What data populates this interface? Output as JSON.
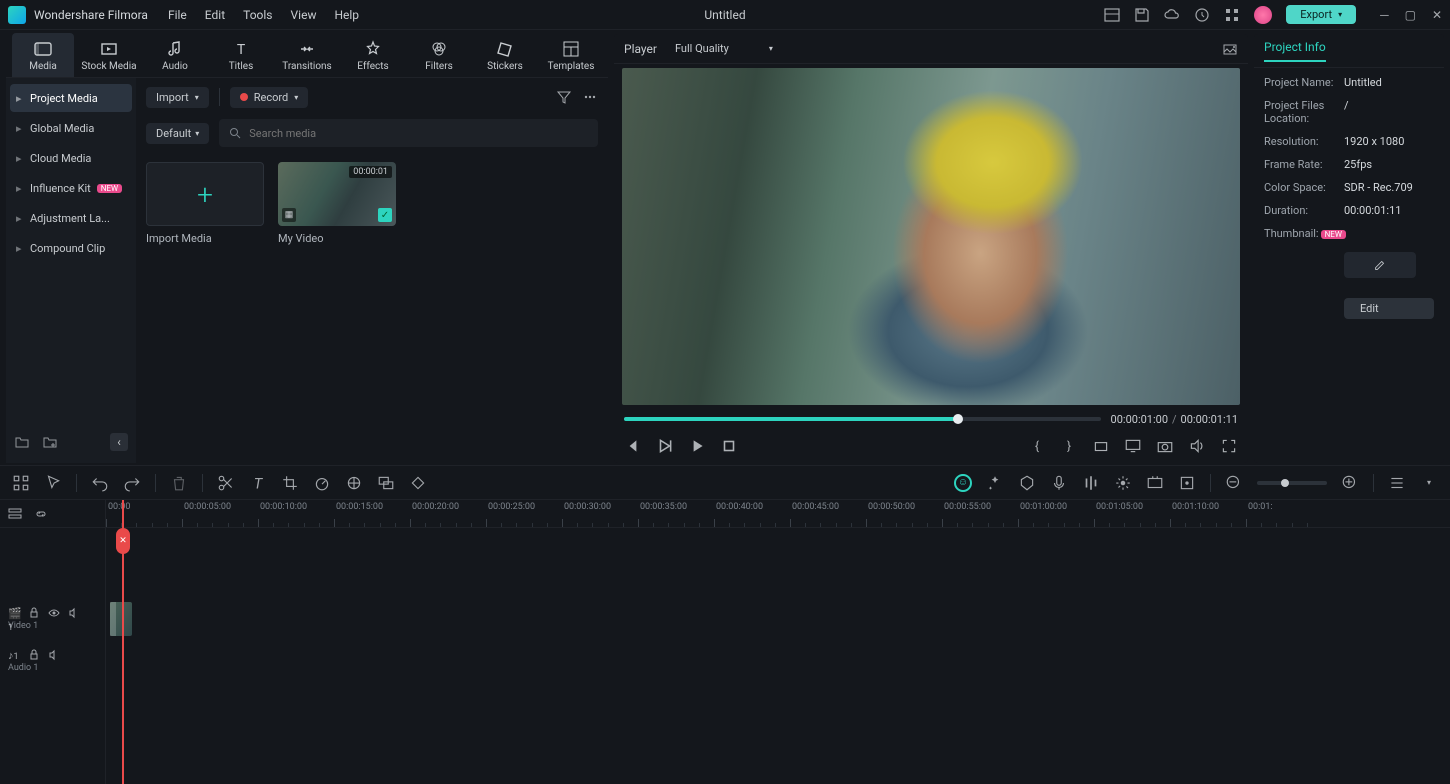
{
  "app": {
    "name": "Wondershare Filmora",
    "document": "Untitled"
  },
  "menu": [
    "File",
    "Edit",
    "Tools",
    "View",
    "Help"
  ],
  "export_label": "Export",
  "asset_tabs": [
    {
      "id": "media",
      "label": "Media"
    },
    {
      "id": "stock",
      "label": "Stock Media"
    },
    {
      "id": "audio",
      "label": "Audio"
    },
    {
      "id": "titles",
      "label": "Titles"
    },
    {
      "id": "transitions",
      "label": "Transitions"
    },
    {
      "id": "effects",
      "label": "Effects"
    },
    {
      "id": "filters",
      "label": "Filters"
    },
    {
      "id": "stickers",
      "label": "Stickers"
    },
    {
      "id": "templates",
      "label": "Templates"
    }
  ],
  "library": {
    "items": [
      {
        "label": "Project Media",
        "active": true
      },
      {
        "label": "Global Media"
      },
      {
        "label": "Cloud Media"
      },
      {
        "label": "Influence Kit",
        "badge": "NEW"
      },
      {
        "label": "Adjustment La..."
      },
      {
        "label": "Compound Clip"
      }
    ]
  },
  "media_tools": {
    "import": "Import",
    "record": "Record",
    "filter": "Default",
    "search_placeholder": "Search media"
  },
  "media_items": [
    {
      "kind": "import",
      "label": "Import Media"
    },
    {
      "kind": "video",
      "label": "My Video",
      "duration": "00:00:01"
    }
  ],
  "player": {
    "title": "Player",
    "quality": "Full Quality",
    "current_tc": "00:00:01:00",
    "total_tc": "00:00:01:11",
    "progress_pct": 70
  },
  "project_info": {
    "tab": "Project Info",
    "rows": {
      "name_k": "Project Name:",
      "name_v": "Untitled",
      "loc_k": "Project Files Location:",
      "loc_v": "/",
      "res_k": "Resolution:",
      "res_v": "1920 x 1080",
      "fps_k": "Frame Rate:",
      "fps_v": "25fps",
      "cs_k": "Color Space:",
      "cs_v": "SDR - Rec.709",
      "dur_k": "Duration:",
      "dur_v": "00:00:01:11",
      "thumb_k": "Thumbnail:"
    },
    "edit": "Edit"
  },
  "timeline": {
    "ticks": [
      "00:00",
      "00:00:05:00",
      "00:00:10:00",
      "00:00:15:00",
      "00:00:20:00",
      "00:00:25:00",
      "00:00:30:00",
      "00:00:35:00",
      "00:00:40:00",
      "00:00:45:00",
      "00:00:50:00",
      "00:00:55:00",
      "00:01:00:00",
      "00:01:05:00",
      "00:01:10:00",
      "00:01:"
    ],
    "tracks": [
      {
        "name": "Video 1",
        "type": "video"
      },
      {
        "name": "Audio 1",
        "type": "audio"
      }
    ]
  }
}
